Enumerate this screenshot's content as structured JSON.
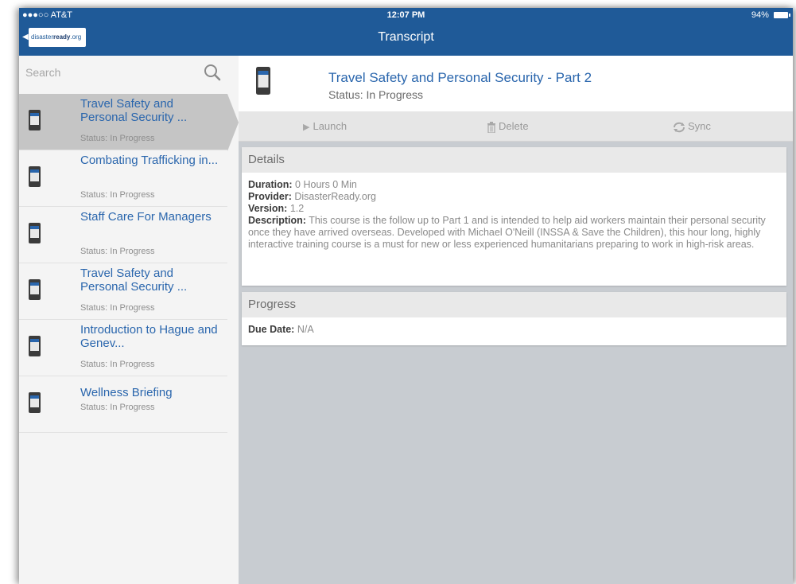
{
  "status_bar": {
    "carrier": "●●●○○ AT&T",
    "time": "12:07 PM",
    "battery": "94%"
  },
  "nav": {
    "title": "Transcript",
    "logo_prefix": "disaster",
    "logo_main": "ready",
    "logo_suffix": ".org"
  },
  "search": {
    "placeholder": "Search"
  },
  "courses": [
    {
      "title": "Travel Safety and Personal Security ...",
      "status": "Status: In Progress"
    },
    {
      "title": "Combating Trafficking in...",
      "status": "Status: In Progress"
    },
    {
      "title": "Staff Care For Managers",
      "status": "Status: In Progress"
    },
    {
      "title": "Travel Safety and Personal Security ...",
      "status": "Status: In Progress"
    },
    {
      "title": "Introduction to Hague and Genev...",
      "status": "Status: In Progress"
    },
    {
      "title": "Wellness Briefing",
      "status": "Status: In Progress"
    }
  ],
  "course_detail": {
    "title": "Travel Safety and Personal Security - Part 2",
    "status": "Status: In Progress"
  },
  "toolbar": {
    "launch": "Launch",
    "delete": "Delete",
    "sync": "Sync"
  },
  "details": {
    "heading": "Details",
    "duration_label": "Duration:",
    "duration_value": "0 Hours 0 Min",
    "provider_label": "Provider:",
    "provider_value": "DisasterReady.org",
    "version_label": "Version:",
    "version_value": "1.2",
    "description_label": "Description:",
    "description_value": "This course is the follow up to Part 1 and is intended to help aid workers maintain their personal security once they have arrived overseas. Developed with Michael O'Neill (INSSA & Save the Children), this hour long, highly interactive training course is a must for new or less experienced humanitarians preparing to work in high-risk areas."
  },
  "progress": {
    "heading": "Progress",
    "due_label": "Due Date:",
    "due_value": "N/A"
  },
  "colors": {
    "nav_blue": "#1f5a98",
    "link_blue": "#2a66ad",
    "selected_row": "#c5c5c5"
  }
}
